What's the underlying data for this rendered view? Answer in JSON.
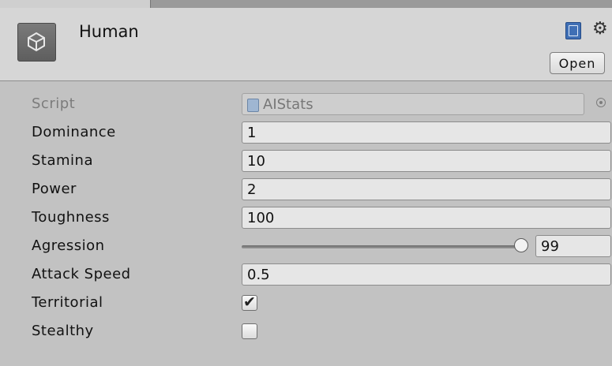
{
  "header": {
    "title": "Human",
    "open_label": "Open",
    "icons": {
      "object": "unity-logo-icon",
      "help": "help-book-icon",
      "settings": "gear-icon"
    }
  },
  "fields": {
    "script": {
      "label": "Script",
      "value": "AIStats"
    },
    "dominance": {
      "label": "Dominance",
      "value": "1"
    },
    "stamina": {
      "label": "Stamina",
      "value": "10"
    },
    "power": {
      "label": "Power",
      "value": "2"
    },
    "toughness": {
      "label": "Toughness",
      "value": "100"
    },
    "agression": {
      "label": "Agression",
      "value": "99",
      "slider_fraction": 0.99
    },
    "attack_speed": {
      "label": "Attack Speed",
      "value": "0.5"
    },
    "territorial": {
      "label": "Territorial",
      "checked": true
    },
    "stealthy": {
      "label": "Stealthy",
      "checked": false
    }
  },
  "colors": {
    "panel": "#c2c2c2",
    "header": "#d6d6d6",
    "help_icon": "#3f6fb5"
  }
}
